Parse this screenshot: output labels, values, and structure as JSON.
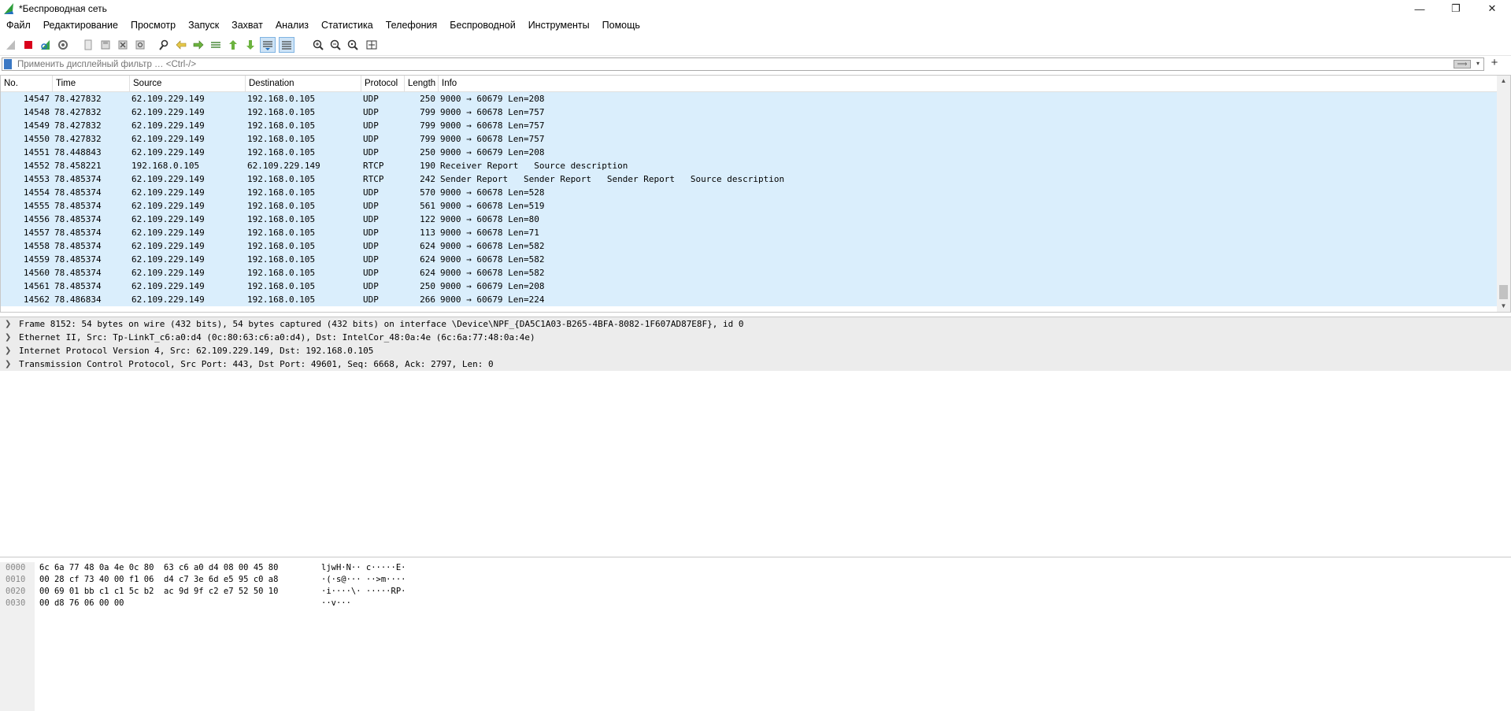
{
  "window": {
    "title": "*Беспроводная сеть",
    "minimize": "—",
    "restore": "❐",
    "close": "✕"
  },
  "menu": [
    "Файл",
    "Редактирование",
    "Просмотр",
    "Запуск",
    "Захват",
    "Анализ",
    "Статистика",
    "Телефония",
    "Беспроводной",
    "Инструменты",
    "Помощь"
  ],
  "filter": {
    "placeholder": "Применить дисплейный фильтр … <Ctrl-/>",
    "apply": "⟹",
    "dropdown": "▾",
    "add": "+"
  },
  "columns": [
    "No.",
    "Time",
    "Source",
    "Destination",
    "Protocol",
    "Length",
    "Info"
  ],
  "packets": [
    {
      "no": "14547",
      "time": "78.427832",
      "src": "62.109.229.149",
      "dst": "192.168.0.105",
      "proto": "UDP",
      "len": "250",
      "info": "9000 → 60679 Len=208"
    },
    {
      "no": "14548",
      "time": "78.427832",
      "src": "62.109.229.149",
      "dst": "192.168.0.105",
      "proto": "UDP",
      "len": "799",
      "info": "9000 → 60678 Len=757"
    },
    {
      "no": "14549",
      "time": "78.427832",
      "src": "62.109.229.149",
      "dst": "192.168.0.105",
      "proto": "UDP",
      "len": "799",
      "info": "9000 → 60678 Len=757"
    },
    {
      "no": "14550",
      "time": "78.427832",
      "src": "62.109.229.149",
      "dst": "192.168.0.105",
      "proto": "UDP",
      "len": "799",
      "info": "9000 → 60678 Len=757"
    },
    {
      "no": "14551",
      "time": "78.448843",
      "src": "62.109.229.149",
      "dst": "192.168.0.105",
      "proto": "UDP",
      "len": "250",
      "info": "9000 → 60679 Len=208"
    },
    {
      "no": "14552",
      "time": "78.458221",
      "src": "192.168.0.105",
      "dst": "62.109.229.149",
      "proto": "RTCP",
      "len": "190",
      "info": "Receiver Report   Source description"
    },
    {
      "no": "14553",
      "time": "78.485374",
      "src": "62.109.229.149",
      "dst": "192.168.0.105",
      "proto": "RTCP",
      "len": "242",
      "info": "Sender Report   Sender Report   Sender Report   Source description"
    },
    {
      "no": "14554",
      "time": "78.485374",
      "src": "62.109.229.149",
      "dst": "192.168.0.105",
      "proto": "UDP",
      "len": "570",
      "info": "9000 → 60678 Len=528"
    },
    {
      "no": "14555",
      "time": "78.485374",
      "src": "62.109.229.149",
      "dst": "192.168.0.105",
      "proto": "UDP",
      "len": "561",
      "info": "9000 → 60678 Len=519"
    },
    {
      "no": "14556",
      "time": "78.485374",
      "src": "62.109.229.149",
      "dst": "192.168.0.105",
      "proto": "UDP",
      "len": "122",
      "info": "9000 → 60678 Len=80"
    },
    {
      "no": "14557",
      "time": "78.485374",
      "src": "62.109.229.149",
      "dst": "192.168.0.105",
      "proto": "UDP",
      "len": "113",
      "info": "9000 → 60678 Len=71"
    },
    {
      "no": "14558",
      "time": "78.485374",
      "src": "62.109.229.149",
      "dst": "192.168.0.105",
      "proto": "UDP",
      "len": "624",
      "info": "9000 → 60678 Len=582"
    },
    {
      "no": "14559",
      "time": "78.485374",
      "src": "62.109.229.149",
      "dst": "192.168.0.105",
      "proto": "UDP",
      "len": "624",
      "info": "9000 → 60678 Len=582"
    },
    {
      "no": "14560",
      "time": "78.485374",
      "src": "62.109.229.149",
      "dst": "192.168.0.105",
      "proto": "UDP",
      "len": "624",
      "info": "9000 → 60678 Len=582"
    },
    {
      "no": "14561",
      "time": "78.485374",
      "src": "62.109.229.149",
      "dst": "192.168.0.105",
      "proto": "UDP",
      "len": "250",
      "info": "9000 → 60679 Len=208"
    },
    {
      "no": "14562",
      "time": "78.486834",
      "src": "62.109.229.149",
      "dst": "192.168.0.105",
      "proto": "UDP",
      "len": "266",
      "info": "9000 → 60679 Len=224"
    }
  ],
  "details": [
    "Frame 8152: 54 bytes on wire (432 bits), 54 bytes captured (432 bits) on interface \\Device\\NPF_{DA5C1A03-B265-4BFA-8082-1F607AD87E8F}, id 0",
    "Ethernet II, Src: Tp-LinkT_c6:a0:d4 (0c:80:63:c6:a0:d4), Dst: IntelCor_48:0a:4e (6c:6a:77:48:0a:4e)",
    "Internet Protocol Version 4, Src: 62.109.229.149, Dst: 192.168.0.105",
    "Transmission Control Protocol, Src Port: 443, Dst Port: 49601, Seq: 6668, Ack: 2797, Len: 0"
  ],
  "hex": [
    {
      "offset": "0000",
      "bytes": "6c 6a 77 48 0a 4e 0c 80  63 c6 a0 d4 08 00 45 80",
      "ascii": "ljwH·N·· c·····E·"
    },
    {
      "offset": "0010",
      "bytes": "00 28 cf 73 40 00 f1 06  d4 c7 3e 6d e5 95 c0 a8",
      "ascii": "·(·s@··· ··>m····"
    },
    {
      "offset": "0020",
      "bytes": "00 69 01 bb c1 c1 5c b2  ac 9d 9f c2 e7 52 50 10",
      "ascii": "·i····\\· ·····RP·"
    },
    {
      "offset": "0030",
      "bytes": "00 d8 76 06 00 00",
      "ascii": "··v···"
    }
  ],
  "colors": {
    "row_highlight": "#daeefc",
    "detail_row": "#ececec",
    "accent": "#3b78c4"
  }
}
